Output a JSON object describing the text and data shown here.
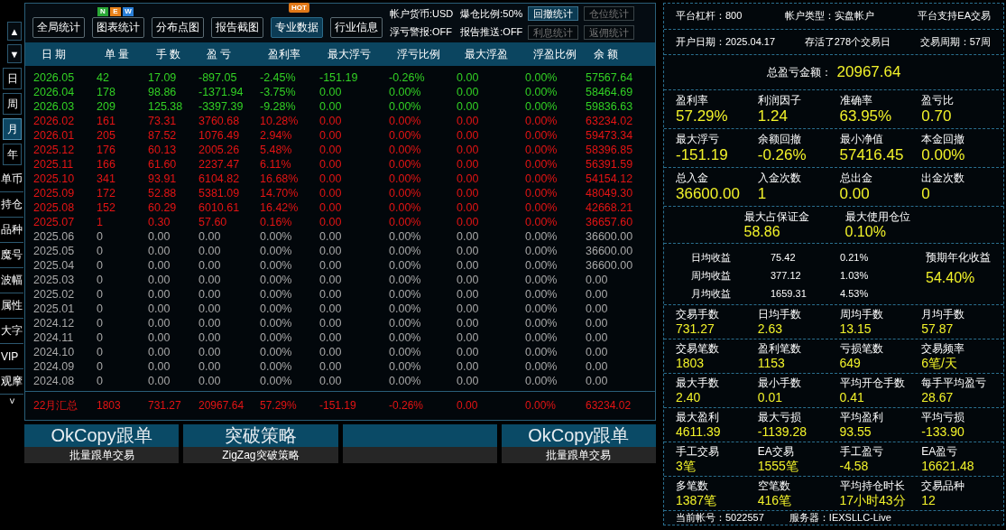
{
  "scroll_buttons": [
    "▲",
    "▼"
  ],
  "side_tabs": [
    {
      "label": "日",
      "selected": false,
      "kind": "box"
    },
    {
      "label": "周",
      "selected": false,
      "kind": "box"
    },
    {
      "label": "月",
      "selected": true,
      "kind": "box"
    },
    {
      "label": "年",
      "selected": false,
      "kind": "box"
    },
    {
      "label": "单币",
      "selected": false,
      "kind": "flat"
    },
    {
      "label": "持仓",
      "selected": false,
      "kind": "flat"
    },
    {
      "label": "品种",
      "selected": false,
      "kind": "flat"
    },
    {
      "label": "魔号",
      "selected": false,
      "kind": "flat"
    },
    {
      "label": "波幅",
      "selected": false,
      "kind": "flat"
    },
    {
      "label": "属性",
      "selected": false,
      "kind": "flat"
    },
    {
      "label": "大字",
      "selected": false,
      "kind": "flat"
    },
    {
      "label": "VIP",
      "selected": false,
      "kind": "flat"
    },
    {
      "label": "观摩",
      "selected": false,
      "kind": "flat"
    }
  ],
  "side_more": "˅",
  "toolbar": {
    "buttons": [
      {
        "label": "全局统计",
        "selected": false
      },
      {
        "label": "图表统计",
        "selected": false,
        "badges": [
          {
            "text": "N",
            "color": "#2aa836"
          },
          {
            "text": "E",
            "color": "#e8821a"
          },
          {
            "text": "W",
            "color": "#2a7fd8"
          }
        ]
      },
      {
        "label": "分布点图",
        "selected": false
      },
      {
        "label": "报告截图",
        "selected": false
      },
      {
        "label": "专业数据",
        "selected": true,
        "hot": "HOT"
      },
      {
        "label": "行业信息",
        "selected": false
      }
    ],
    "info": [
      "帐户货币:USD",
      "爆仓比例:50%",
      "浮亏警报:OFF",
      "报告推送:OFF"
    ],
    "small_buttons": [
      {
        "label": "回撤统计",
        "disabled": false
      },
      {
        "label": "仓位统计",
        "disabled": true
      },
      {
        "label": "利息统计",
        "disabled": true
      },
      {
        "label": "返佣统计",
        "disabled": true
      }
    ]
  },
  "table": {
    "columns": [
      "日 期",
      "单 量",
      "手 数",
      "盈 亏",
      "盈利率",
      "最大浮亏",
      "浮亏比例",
      "最大浮盈",
      "浮盈比例",
      "余 额"
    ],
    "rows": [
      {
        "color": "#32d024",
        "cells": [
          "2026.05",
          "42",
          "17.09",
          "-897.05",
          "-2.45%",
          "-151.19",
          "-0.26%",
          "0.00",
          "0.00%",
          "57567.64"
        ]
      },
      {
        "color": "#32d024",
        "cells": [
          "2026.04",
          "178",
          "98.86",
          "-1371.94",
          "-3.75%",
          "0.00",
          "0.00%",
          "0.00",
          "0.00%",
          "58464.69"
        ]
      },
      {
        "color": "#32d024",
        "cells": [
          "2026.03",
          "209",
          "125.38",
          "-3397.39",
          "-9.28%",
          "0.00",
          "0.00%",
          "0.00",
          "0.00%",
          "59836.63"
        ]
      },
      {
        "color": "#e41414",
        "cells": [
          "2026.02",
          "161",
          "73.31",
          "3760.68",
          "10.28%",
          "0.00",
          "0.00%",
          "0.00",
          "0.00%",
          "63234.02"
        ]
      },
      {
        "color": "#e41414",
        "cells": [
          "2026.01",
          "205",
          "87.52",
          "1076.49",
          "2.94%",
          "0.00",
          "0.00%",
          "0.00",
          "0.00%",
          "59473.34"
        ]
      },
      {
        "color": "#e41414",
        "cells": [
          "2025.12",
          "176",
          "60.13",
          "2005.26",
          "5.48%",
          "0.00",
          "0.00%",
          "0.00",
          "0.00%",
          "58396.85"
        ]
      },
      {
        "color": "#e41414",
        "cells": [
          "2025.11",
          "166",
          "61.60",
          "2237.47",
          "6.11%",
          "0.00",
          "0.00%",
          "0.00",
          "0.00%",
          "56391.59"
        ]
      },
      {
        "color": "#e41414",
        "cells": [
          "2025.10",
          "341",
          "93.91",
          "6104.82",
          "16.68%",
          "0.00",
          "0.00%",
          "0.00",
          "0.00%",
          "54154.12"
        ]
      },
      {
        "color": "#e41414",
        "cells": [
          "2025.09",
          "172",
          "52.88",
          "5381.09",
          "14.70%",
          "0.00",
          "0.00%",
          "0.00",
          "0.00%",
          "48049.30"
        ]
      },
      {
        "color": "#e41414",
        "cells": [
          "2025.08",
          "152",
          "60.29",
          "6010.61",
          "16.42%",
          "0.00",
          "0.00%",
          "0.00",
          "0.00%",
          "42668.21"
        ]
      },
      {
        "color": "#e41414",
        "cells": [
          "2025.07",
          "1",
          "0.30",
          "57.60",
          "0.16%",
          "0.00",
          "0.00%",
          "0.00",
          "0.00%",
          "36657.60"
        ]
      },
      {
        "color": "#a8a8a8",
        "cells": [
          "2025.06",
          "0",
          "0.00",
          "0.00",
          "0.00%",
          "0.00",
          "0.00%",
          "0.00",
          "0.00%",
          "36600.00"
        ]
      },
      {
        "color": "#a8a8a8",
        "cells": [
          "2025.05",
          "0",
          "0.00",
          "0.00",
          "0.00%",
          "0.00",
          "0.00%",
          "0.00",
          "0.00%",
          "36600.00"
        ]
      },
      {
        "color": "#a8a8a8",
        "cells": [
          "2025.04",
          "0",
          "0.00",
          "0.00",
          "0.00%",
          "0.00",
          "0.00%",
          "0.00",
          "0.00%",
          "36600.00"
        ]
      },
      {
        "color": "#a8a8a8",
        "cells": [
          "2025.03",
          "0",
          "0.00",
          "0.00",
          "0.00%",
          "0.00",
          "0.00%",
          "0.00",
          "0.00%",
          "0.00"
        ]
      },
      {
        "color": "#a8a8a8",
        "cells": [
          "2025.02",
          "0",
          "0.00",
          "0.00",
          "0.00%",
          "0.00",
          "0.00%",
          "0.00",
          "0.00%",
          "0.00"
        ]
      },
      {
        "color": "#a8a8a8",
        "cells": [
          "2025.01",
          "0",
          "0.00",
          "0.00",
          "0.00%",
          "0.00",
          "0.00%",
          "0.00",
          "0.00%",
          "0.00"
        ]
      },
      {
        "color": "#a8a8a8",
        "cells": [
          "2024.12",
          "0",
          "0.00",
          "0.00",
          "0.00%",
          "0.00",
          "0.00%",
          "0.00",
          "0.00%",
          "0.00"
        ]
      },
      {
        "color": "#a8a8a8",
        "cells": [
          "2024.11",
          "0",
          "0.00",
          "0.00",
          "0.00%",
          "0.00",
          "0.00%",
          "0.00",
          "0.00%",
          "0.00"
        ]
      },
      {
        "color": "#a8a8a8",
        "cells": [
          "2024.10",
          "0",
          "0.00",
          "0.00",
          "0.00%",
          "0.00",
          "0.00%",
          "0.00",
          "0.00%",
          "0.00"
        ]
      },
      {
        "color": "#a8a8a8",
        "cells": [
          "2024.09",
          "0",
          "0.00",
          "0.00",
          "0.00%",
          "0.00",
          "0.00%",
          "0.00",
          "0.00%",
          "0.00"
        ]
      },
      {
        "color": "#a8a8a8",
        "cells": [
          "2024.08",
          "0",
          "0.00",
          "0.00",
          "0.00%",
          "0.00",
          "0.00%",
          "0.00",
          "0.00%",
          "0.00"
        ]
      }
    ],
    "summary": {
      "color": "#e41414",
      "cells": [
        "22月汇总",
        "1803",
        "731.27",
        "20967.64",
        "57.29%",
        "-151.19",
        "-0.26%",
        "0.00",
        "0.00%",
        "63234.02"
      ]
    }
  },
  "promos": [
    {
      "kind": "ad",
      "title": "OkCopy跟单",
      "subtitle": "批量跟单交易"
    },
    {
      "kind": "ad",
      "title": "突破策略",
      "subtitle": "ZigZag突破策略"
    },
    {
      "kind": "blank"
    },
    {
      "kind": "ad",
      "title": "OkCopy跟单",
      "subtitle": "批量跟单交易"
    }
  ],
  "account": {
    "line1": [
      "平台杠杆：800",
      "帐户类型：实盘帐户",
      "平台支持EA交易"
    ],
    "line2": [
      "开户日期：2025.04.17",
      "存活了278个交易日",
      "交易周期：57周"
    ],
    "total_label": "总盈亏金额：",
    "total_value": "20967.64",
    "groups": [
      {
        "kind": "large",
        "items": [
          {
            "label": "盈利率",
            "value": "57.29%"
          },
          {
            "label": "利润因子",
            "value": "1.24"
          },
          {
            "label": "准确率",
            "value": "63.95%"
          },
          {
            "label": "盈亏比",
            "value": "0.70"
          }
        ]
      },
      {
        "kind": "large",
        "items": [
          {
            "label": "最大浮亏",
            "value": "-151.19"
          },
          {
            "label": "余额回撤",
            "value": "-0.26%"
          },
          {
            "label": "最小净值",
            "value": "57416.45"
          },
          {
            "label": "本金回撤",
            "value": "0.00%"
          }
        ]
      },
      {
        "kind": "large",
        "items": [
          {
            "label": "总入金",
            "value": "36600.00"
          },
          {
            "label": "入金次数",
            "value": "1"
          },
          {
            "label": "总出金",
            "value": "0.00"
          },
          {
            "label": "出金次数",
            "value": "0"
          }
        ]
      },
      {
        "kind": "pair",
        "items": [
          {
            "label": "最大占保证金",
            "value": "58.86"
          },
          {
            "label": "最大使用仓位",
            "value": "0.10%"
          }
        ]
      }
    ],
    "averages": [
      [
        "日均收益",
        "75.42",
        "0.21%"
      ],
      [
        "周均收益",
        "377.12",
        "1.03%"
      ],
      [
        "月均收益",
        "1659.31",
        "4.53%"
      ]
    ],
    "annual_label": "预期年化收益",
    "annual_value": "54.40%",
    "small_groups": [
      [
        {
          "label": "交易手数",
          "value": "731.27"
        },
        {
          "label": "日均手数",
          "value": "2.63"
        },
        {
          "label": "周均手数",
          "value": "13.15"
        },
        {
          "label": "月均手数",
          "value": "57.87"
        }
      ],
      [
        {
          "label": "交易笔数",
          "value": "1803"
        },
        {
          "label": "盈利笔数",
          "value": "1153"
        },
        {
          "label": "亏损笔数",
          "value": "649"
        },
        {
          "label": "交易频率",
          "value": "6笔/天"
        }
      ],
      [
        {
          "label": "最大手数",
          "value": "2.40"
        },
        {
          "label": "最小手数",
          "value": "0.01"
        },
        {
          "label": "平均开仓手数",
          "value": "0.41"
        },
        {
          "label": "每手平均盈亏",
          "value": "28.67"
        }
      ],
      [
        {
          "label": "最大盈利",
          "value": "4611.39"
        },
        {
          "label": "最大亏损",
          "value": "-1139.28"
        },
        {
          "label": "平均盈利",
          "value": "93.55"
        },
        {
          "label": "平均亏损",
          "value": "-133.90"
        }
      ],
      [
        {
          "label": "手工交易",
          "value": "3笔"
        },
        {
          "label": "EA交易",
          "value": "1555笔"
        },
        {
          "label": "手工盈亏",
          "value": "-4.58"
        },
        {
          "label": "EA盈亏",
          "value": "16621.48"
        }
      ],
      [
        {
          "label": "多笔数",
          "value": "1387笔"
        },
        {
          "label": "空笔数",
          "value": "416笔"
        },
        {
          "label": "平均持仓时长",
          "value": "17小时43分"
        },
        {
          "label": "交易品种",
          "value": "12"
        }
      ]
    ],
    "footer": [
      "当前帐号：5022557",
      "服务器：IEXSLLC-Live"
    ]
  }
}
